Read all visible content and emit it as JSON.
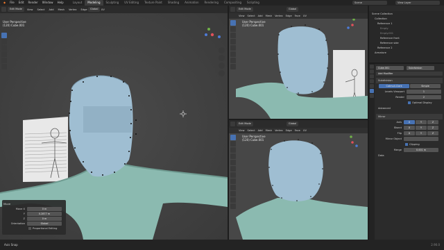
{
  "topbar": {
    "menus": [
      "File",
      "Edit",
      "Render",
      "Window",
      "Help"
    ],
    "workspaces": [
      "Layout",
      "Modeling",
      "Sculpting",
      "UV Editing",
      "Texture Paint",
      "Shading",
      "Animation",
      "Rendering",
      "Compositing",
      "Scripting"
    ],
    "active_workspace": "Modeling",
    "scene_label": "Scene",
    "view_layer_label": "View Layer"
  },
  "viewport_main": {
    "mode": "Edit Mode",
    "menus": [
      "View",
      "Select",
      "Add",
      "Mesh",
      "Vertex",
      "Edge",
      "Face",
      "UV"
    ],
    "orientation": "Global",
    "view_name": "User Perspective",
    "object_info": "(120) Cube.001"
  },
  "viewport_top_right": {
    "mode": "Edit Mode",
    "menus": [
      "View",
      "Select",
      "Add",
      "Mesh",
      "Vertex",
      "Edge",
      "Face",
      "UV"
    ],
    "orientation": "Global",
    "view_name": "User Perspective",
    "object_info": "(120) Cube.001"
  },
  "viewport_bottom_right": {
    "mode": "Edit Mode",
    "menus": [
      "View",
      "Select",
      "Add",
      "Mesh",
      "Vertex",
      "Edge",
      "Face",
      "UV"
    ],
    "orientation": "Global",
    "view_name": "User Perspective",
    "object_info": "(120) Cube.001"
  },
  "operator_panel": {
    "title": "Move",
    "move_x_label": "Move X",
    "move_x_value": "0 m",
    "y_label": "Y",
    "y_value": "0.2877 m",
    "z_label": "Z",
    "z_value": "0 m",
    "orientation_label": "Orientation",
    "orientation_value": "Global",
    "proportional_label": "Proportional Editing"
  },
  "outliner": {
    "items": [
      {
        "label": "Scene Collection"
      },
      {
        "label": "Collection"
      },
      {
        "label": "Reference 1"
      },
      {
        "label": "Empty"
      },
      {
        "label": "Empty.001"
      },
      {
        "label": "Reference front"
      },
      {
        "label": "Reference side"
      },
      {
        "label": "Reference 2"
      },
      {
        "label": "Armature"
      }
    ]
  },
  "properties": {
    "object_name": "Cube.001",
    "modifier_name": "Subdivision",
    "add_modifier_label": "Add Modifier",
    "subsurf_name": "Subdivision",
    "catmull_label": "Catmull-Clark",
    "simple_label": "Simple",
    "levels_viewport_label": "Levels Viewport",
    "levels_viewport_value": "1",
    "render_label": "Render",
    "render_value": "2",
    "optimal_label": "Optimal Display",
    "advanced_label": "Advanced",
    "mirror_name": "Mirror",
    "axis_label": "Axis",
    "bisect_label": "Bisect",
    "flip_label": "Flip",
    "axis_x": "X",
    "axis_y": "Y",
    "axis_z": "Z",
    "mirror_object_label": "Mirror Object",
    "clipping_label": "Clipping",
    "merge_label": "Merge",
    "merge_value": "0.001 m",
    "data_label": "Data"
  },
  "statusbar": {
    "left_text": "Axis Snap",
    "right_text": "2.90.0"
  }
}
